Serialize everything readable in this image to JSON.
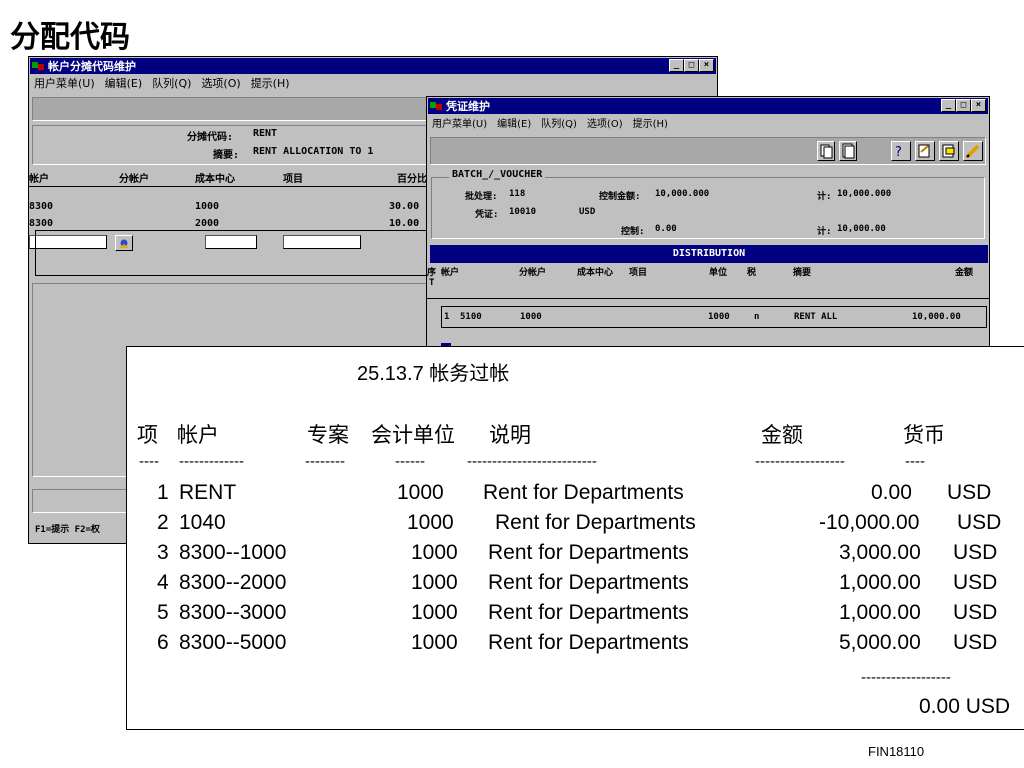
{
  "slide": {
    "title": "分配代码",
    "footer_code": "FIN18110"
  },
  "window1": {
    "title": "帐户分摊代码维护",
    "menu": [
      "用户菜单(U)",
      "编辑(E)",
      "队列(Q)",
      "选项(O)",
      "提示(H)"
    ],
    "alloc_code_label": "分摊代码:",
    "alloc_code_value": "RENT",
    "desc_label": "摘要:",
    "desc_value": "RENT ALLOCATION TO 1",
    "columns": [
      "帐户",
      "分帐户",
      "成本中心",
      "项目",
      "百分比"
    ],
    "rows": [
      {
        "account": "8300",
        "cost_center": "1000",
        "percent": "30.00"
      },
      {
        "account": "8300",
        "cost_center": "2000",
        "percent": "10.00"
      }
    ],
    "status_text": "F1=提示 F2=权"
  },
  "window2": {
    "title": "凭证维护",
    "menu": [
      "用户菜单(U)",
      "编辑(E)",
      "队列(Q)",
      "选项(O)",
      "提示(H)"
    ],
    "group_title": "BATCH_/_VOUCHER",
    "batch_label": "批处理:",
    "batch_value": "118",
    "ctrl_amount_label": "控制金额:",
    "ctrl_amount_value": "10,000.000",
    "total_label_1": "计:",
    "total_value_1": "10,000.000",
    "voucher_label": "凭证:",
    "voucher_value": "10010",
    "currency": "USD",
    "control_label": "控制:",
    "control_value": "0.00",
    "total_label_2": "计:",
    "total_value_2": "10,000.00",
    "dist_title": "DISTRIBUTION",
    "dist_columns": [
      "序",
      "帐户",
      "分帐户",
      "成本中心",
      "项目",
      "单位",
      "税",
      "摘要",
      "金额"
    ],
    "dist_t": "T",
    "dist_row": {
      "seq": "1",
      "account": "5100",
      "sub_account": "1000",
      "unit": "1000",
      "tax": "n",
      "desc": "RENT ALL",
      "amount": "10,000.00"
    }
  },
  "posting": {
    "title": "25.13.7 帐务过帐",
    "headers": {
      "item": "项",
      "account": "帐户",
      "project": "专案",
      "unit": "会计单位",
      "desc": "说明",
      "amount": "金额",
      "currency": "货币"
    },
    "dash_item": "----",
    "dash_account": "-------------",
    "dash_project": "--------",
    "dash_unit": "------",
    "dash_desc": "--------------------------",
    "dash_amount": "------------------",
    "dash_currency": "----",
    "rows": [
      {
        "no": "1",
        "account": "RENT",
        "unit": "1000",
        "desc": "Rent for Departments",
        "amount": "0.00",
        "currency": "USD"
      },
      {
        "no": "2",
        "account": "1040",
        "unit": "1000",
        "desc": "Rent for Departments",
        "amount": "-10,000.00",
        "currency": "USD"
      },
      {
        "no": "3",
        "account": "8300--1000",
        "unit": "1000",
        "desc": "Rent for Departments",
        "amount": "3,000.00",
        "currency": "USD"
      },
      {
        "no": "4",
        "account": "8300--2000",
        "unit": "1000",
        "desc": "Rent for Departments",
        "amount": "1,000.00",
        "currency": "USD"
      },
      {
        "no": "5",
        "account": "8300--3000",
        "unit": "1000",
        "desc": "Rent for Departments",
        "amount": "1,000.00",
        "currency": "USD"
      },
      {
        "no": "6",
        "account": "8300--5000",
        "unit": "1000",
        "desc": "Rent for Departments",
        "amount": "5,000.00",
        "currency": "USD"
      }
    ],
    "total_dash": "------------------",
    "total": "0.00 USD"
  }
}
